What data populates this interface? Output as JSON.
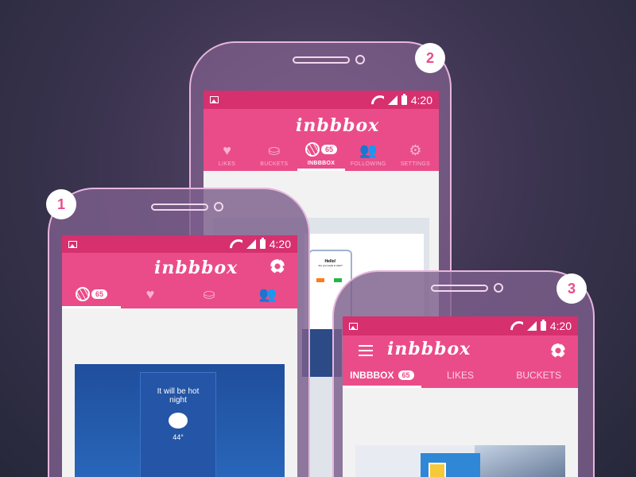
{
  "callouts": {
    "one": "1",
    "two": "2",
    "three": "3"
  },
  "status": {
    "time": "4:20"
  },
  "brand": "inbbbox",
  "phone2": {
    "tabs": [
      {
        "label": "LIKES",
        "icon": "heart-icon"
      },
      {
        "label": "BUCKETS",
        "icon": "bucket-icon"
      },
      {
        "label": "INBBBOX",
        "icon": "dribbble-ball-icon",
        "badge": "65"
      },
      {
        "label": "FOLLOWING",
        "icon": "people-icon"
      },
      {
        "label": "SETTINGS",
        "icon": "gear-icon"
      }
    ],
    "card": {
      "title": "Hello!",
      "text": "Are you ready to start?"
    }
  },
  "phone1": {
    "badge": "65",
    "card": {
      "weather_title": "It will be hot night",
      "temperature": "44°"
    }
  },
  "phone3": {
    "tabs": [
      {
        "label": "INBBBOX",
        "badge": "65"
      },
      {
        "label": "LIKES"
      },
      {
        "label": "BUCKETS"
      }
    ]
  },
  "colors": {
    "accent": "#ea4c89",
    "statusbar": "#d6306f",
    "background": "#2f2e44"
  }
}
